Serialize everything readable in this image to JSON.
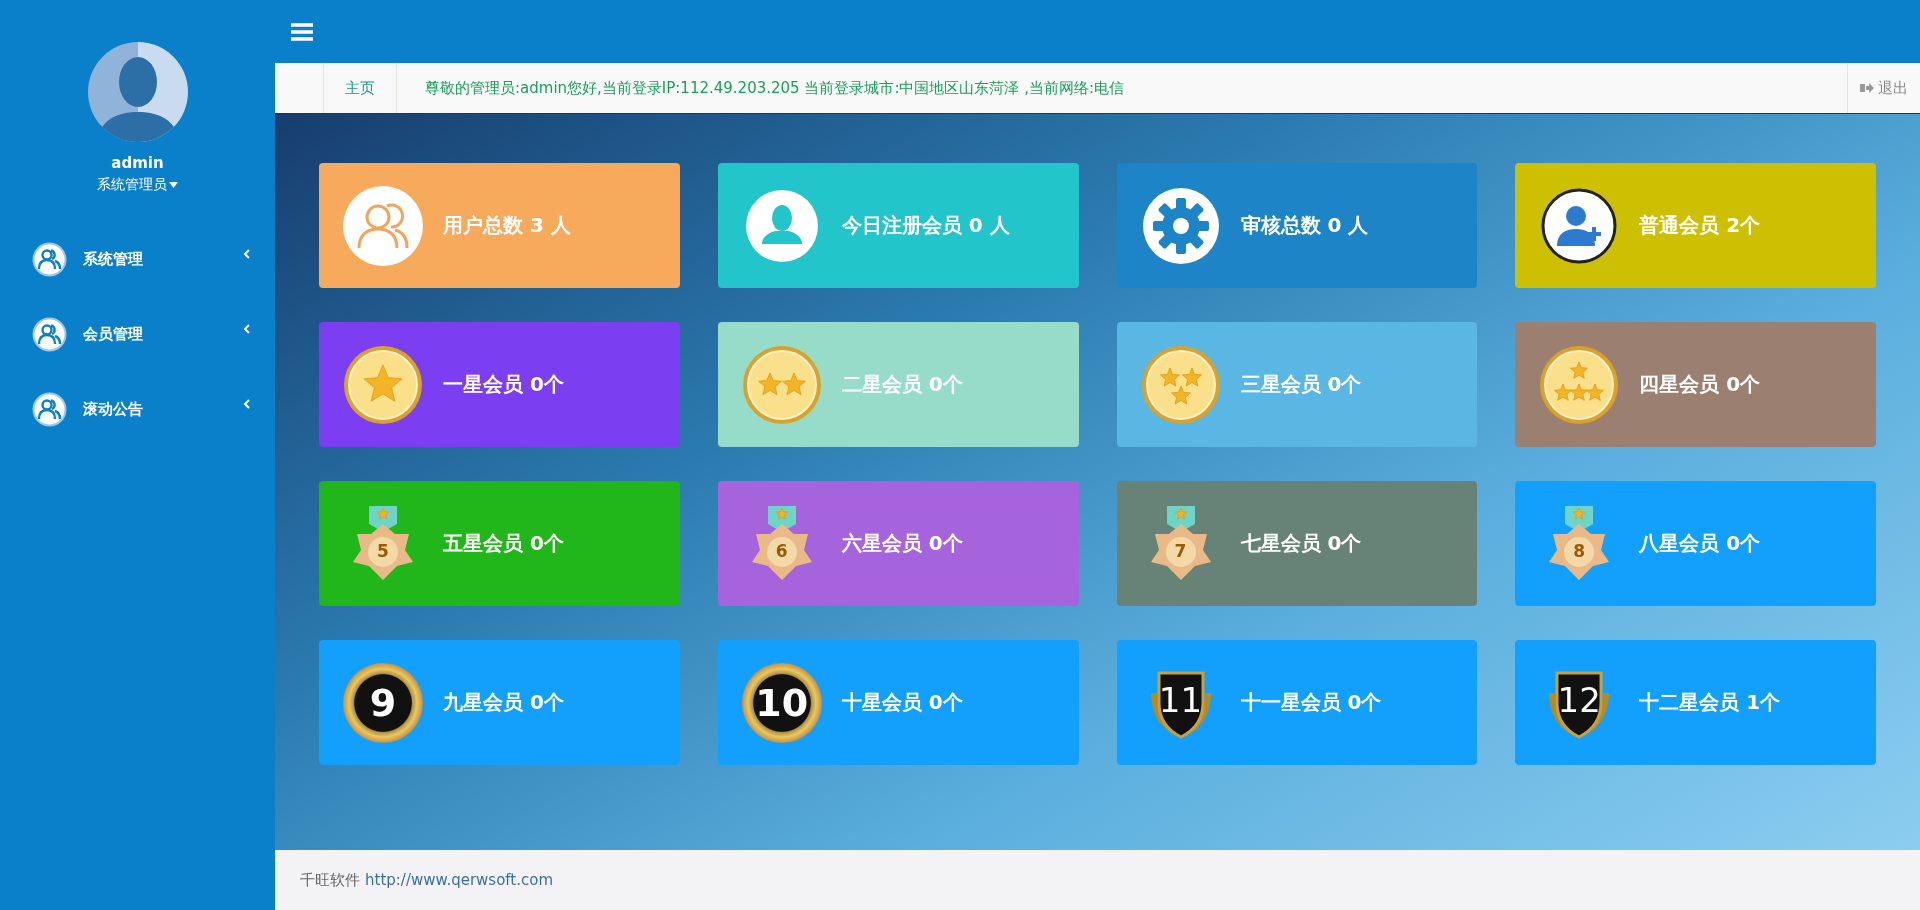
{
  "sidebar": {
    "user": {
      "name": "admin",
      "role": "系统管理员"
    },
    "items": [
      {
        "label": "系统管理",
        "expanded": false
      },
      {
        "label": "会员管理",
        "expanded": false
      },
      {
        "label": "滚动公告",
        "expanded": false
      }
    ]
  },
  "tabs": [
    {
      "label": "主页",
      "selected": true
    }
  ],
  "welcome": "尊敬的管理员:admin您好,当前登录IP:112.49.203.205 当前登录城市:中国地区山东菏泽 ,当前网络:电信",
  "logout": "退出",
  "cards": [
    {
      "label": "用户总数 3 人",
      "color": "#f8aa5c",
      "kind": "users"
    },
    {
      "label": "今日注册会员 0 人",
      "color": "#22c5c9",
      "kind": "user"
    },
    {
      "label": "审核总数 0 人",
      "color": "#1e84c8",
      "kind": "gear"
    },
    {
      "label": "普通会员 2个",
      "color": "#cdbf02",
      "kind": "user-plus"
    },
    {
      "label": "一星会员 0个",
      "color": "#7b3ef0",
      "kind": "coin-1"
    },
    {
      "label": "二星会员 0个",
      "color": "#96dcc8",
      "kind": "coin-2"
    },
    {
      "label": "三星会员 0个",
      "color": "#5ab6e2",
      "kind": "coin-3"
    },
    {
      "label": "四星会员 0个",
      "color": "#9b7f70",
      "kind": "coin-4"
    },
    {
      "label": "五星会员 0个",
      "color": "#21b619",
      "kind": "ribbon-medal",
      "badge": "5"
    },
    {
      "label": "六星会员 0个",
      "color": "#a563dc",
      "kind": "ribbon-medal",
      "badge": "6"
    },
    {
      "label": "七星会员 0个",
      "color": "#678378",
      "kind": "ribbon-medal",
      "badge": "7"
    },
    {
      "label": "八星会员 0个",
      "color": "#13a0fd",
      "kind": "ribbon-medal",
      "badge": "8"
    },
    {
      "label": "九星会员 0个",
      "color": "#13a0fd",
      "kind": "ring-badge",
      "badge": "9"
    },
    {
      "label": "十星会员 0个",
      "color": "#13a0fd",
      "kind": "ring-badge",
      "badge": "10"
    },
    {
      "label": "十一星会员 0个",
      "color": "#13a0fd",
      "kind": "shield-badge",
      "badge": "11"
    },
    {
      "label": "十二星会员 1个",
      "color": "#13a0fd",
      "kind": "shield-badge",
      "badge": "12"
    }
  ],
  "footer": {
    "company": "千旺软件",
    "link": "http://www.qerwsoft.com"
  }
}
